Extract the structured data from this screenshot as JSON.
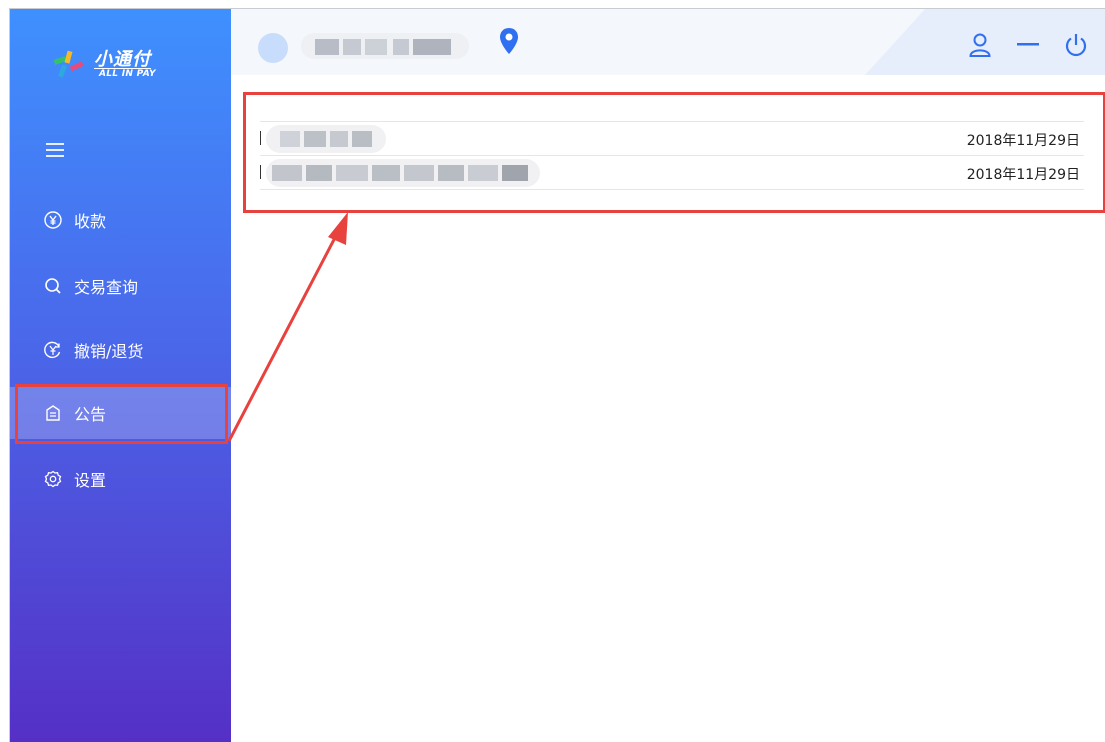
{
  "logo": {
    "name": "小通付",
    "sub": "ALL IN PAY"
  },
  "nav": [
    {
      "label": "收款",
      "icon": "yen-circle-icon"
    },
    {
      "label": "交易查询",
      "icon": "search-icon"
    },
    {
      "label": "撤销/退货",
      "icon": "refund-icon"
    },
    {
      "label": "公告",
      "icon": "notice-icon",
      "active": true
    },
    {
      "label": "设置",
      "icon": "settings-icon"
    }
  ],
  "notices": [
    {
      "date": "2018年11月29日"
    },
    {
      "date": "2018年11月29日"
    }
  ],
  "colors": {
    "accent": "#3f90ff",
    "highlight": "#e8423f",
    "sidebar_bottom": "#5530c6"
  }
}
